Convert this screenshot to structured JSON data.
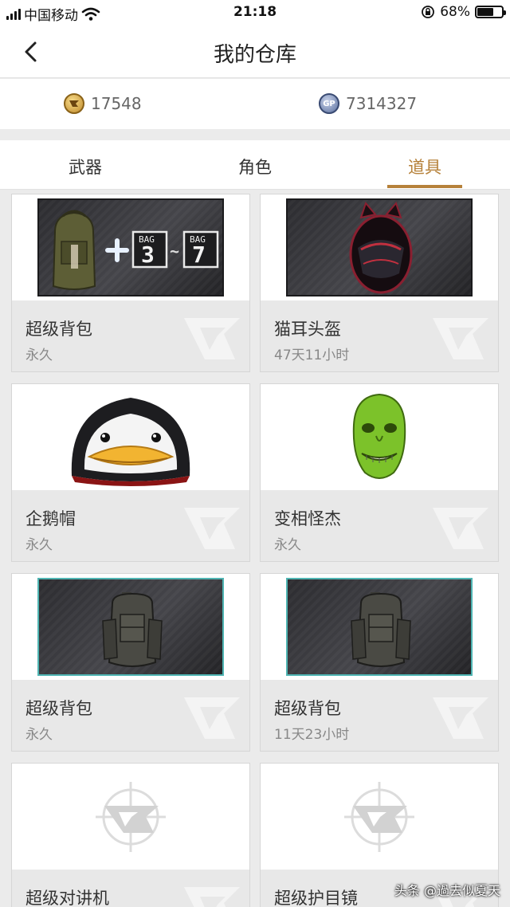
{
  "status_bar": {
    "carrier": "中国移动",
    "time": "21:18",
    "battery_percent": "68%",
    "battery_level": 0.68
  },
  "nav": {
    "title": "我的仓库",
    "back_icon": "chevron-left-icon"
  },
  "currency": {
    "cf_points": "17548",
    "gp_points": "7314327",
    "gp_label": "GP"
  },
  "tabs": [
    {
      "label": "武器",
      "active": false
    },
    {
      "label": "角色",
      "active": false
    },
    {
      "label": "道具",
      "active": true
    }
  ],
  "items": [
    {
      "name": "超级背包",
      "duration": "永久"
    },
    {
      "name": "猫耳头盔",
      "duration": "47天11小时"
    },
    {
      "name": "企鹅帽",
      "duration": "永久"
    },
    {
      "name": "变相怪杰",
      "duration": "永久"
    },
    {
      "name": "超级背包",
      "duration": "永久"
    },
    {
      "name": "超级背包",
      "duration": "11天23小时"
    },
    {
      "name": "超级对讲机",
      "duration": ""
    },
    {
      "name": "超级护目镜",
      "duration": ""
    }
  ],
  "bag_banner": {
    "label": "BAG",
    "from": "3",
    "sep": "~",
    "to": "7"
  },
  "colors": {
    "accent": "#b6813a",
    "background": "#ebebeb"
  },
  "footer": {
    "watermark": "头条 @過去似夏天"
  }
}
